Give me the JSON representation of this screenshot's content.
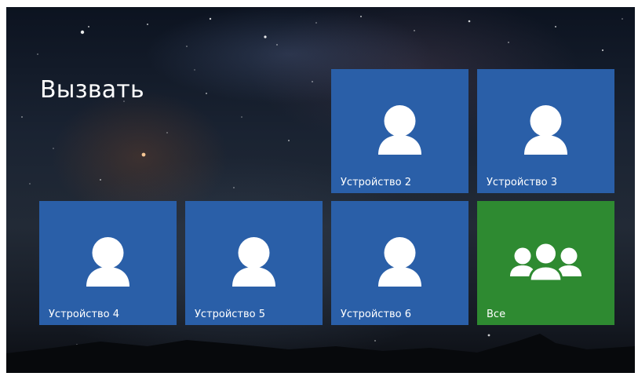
{
  "screen": {
    "title": "Вызвать"
  },
  "tiles": [
    {
      "label": "Устройство 2",
      "icon": "person-icon",
      "color": "#2a5fa8"
    },
    {
      "label": "Устройство 3",
      "icon": "person-icon",
      "color": "#2a5fa8"
    },
    {
      "label": "Устройство 4",
      "icon": "person-icon",
      "color": "#2a5fa8"
    },
    {
      "label": "Устройство 5",
      "icon": "person-icon",
      "color": "#2a5fa8"
    },
    {
      "label": "Устройство 6",
      "icon": "person-icon",
      "color": "#2a5fa8"
    },
    {
      "label": "Все",
      "icon": "group-icon",
      "color": "#2e8a31"
    }
  ]
}
